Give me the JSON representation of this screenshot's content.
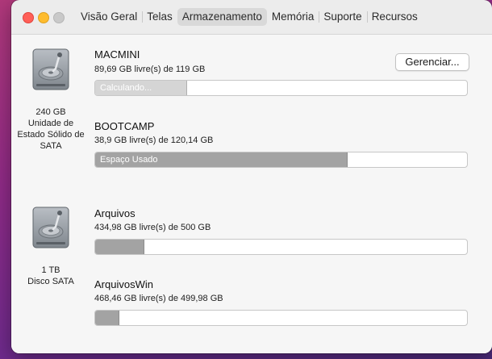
{
  "tabs": [
    {
      "label": "Visão Geral"
    },
    {
      "label": "Telas"
    },
    {
      "label": "Armazenamento",
      "active": true
    },
    {
      "label": "Memória"
    },
    {
      "label": "Suporte"
    },
    {
      "label": "Recursos"
    }
  ],
  "drives": [
    {
      "icon": "hard-drive-icon",
      "caption": [
        "240 GB",
        "Unidade de",
        "Estado Sólido de",
        "SATA"
      ],
      "volumes": [
        {
          "name": "MACMINI",
          "free": "89,69 GB livre(s) de 119 GB",
          "used_fraction": 0.246,
          "bar_label": "Calculando...",
          "style": "calculating"
        },
        {
          "name": "BOOTCAMP",
          "free": "38,9 GB livre(s) de 120,14 GB",
          "used_fraction": 0.676,
          "bar_label": "Espaço Usado",
          "style": "used"
        }
      ]
    },
    {
      "icon": "hard-drive-icon",
      "caption": [
        "1 TB",
        "Disco SATA"
      ],
      "volumes": [
        {
          "name": "Arquivos",
          "free": "434,98 GB livre(s) de 500 GB",
          "used_fraction": 0.13,
          "bar_label": "",
          "style": "used"
        },
        {
          "name": "ArquivosWin",
          "free": "468,46 GB livre(s) de 499,98 GB",
          "used_fraction": 0.063,
          "bar_label": "",
          "style": "used"
        }
      ]
    }
  ],
  "manage_button": {
    "label": "Gerenciar..."
  }
}
